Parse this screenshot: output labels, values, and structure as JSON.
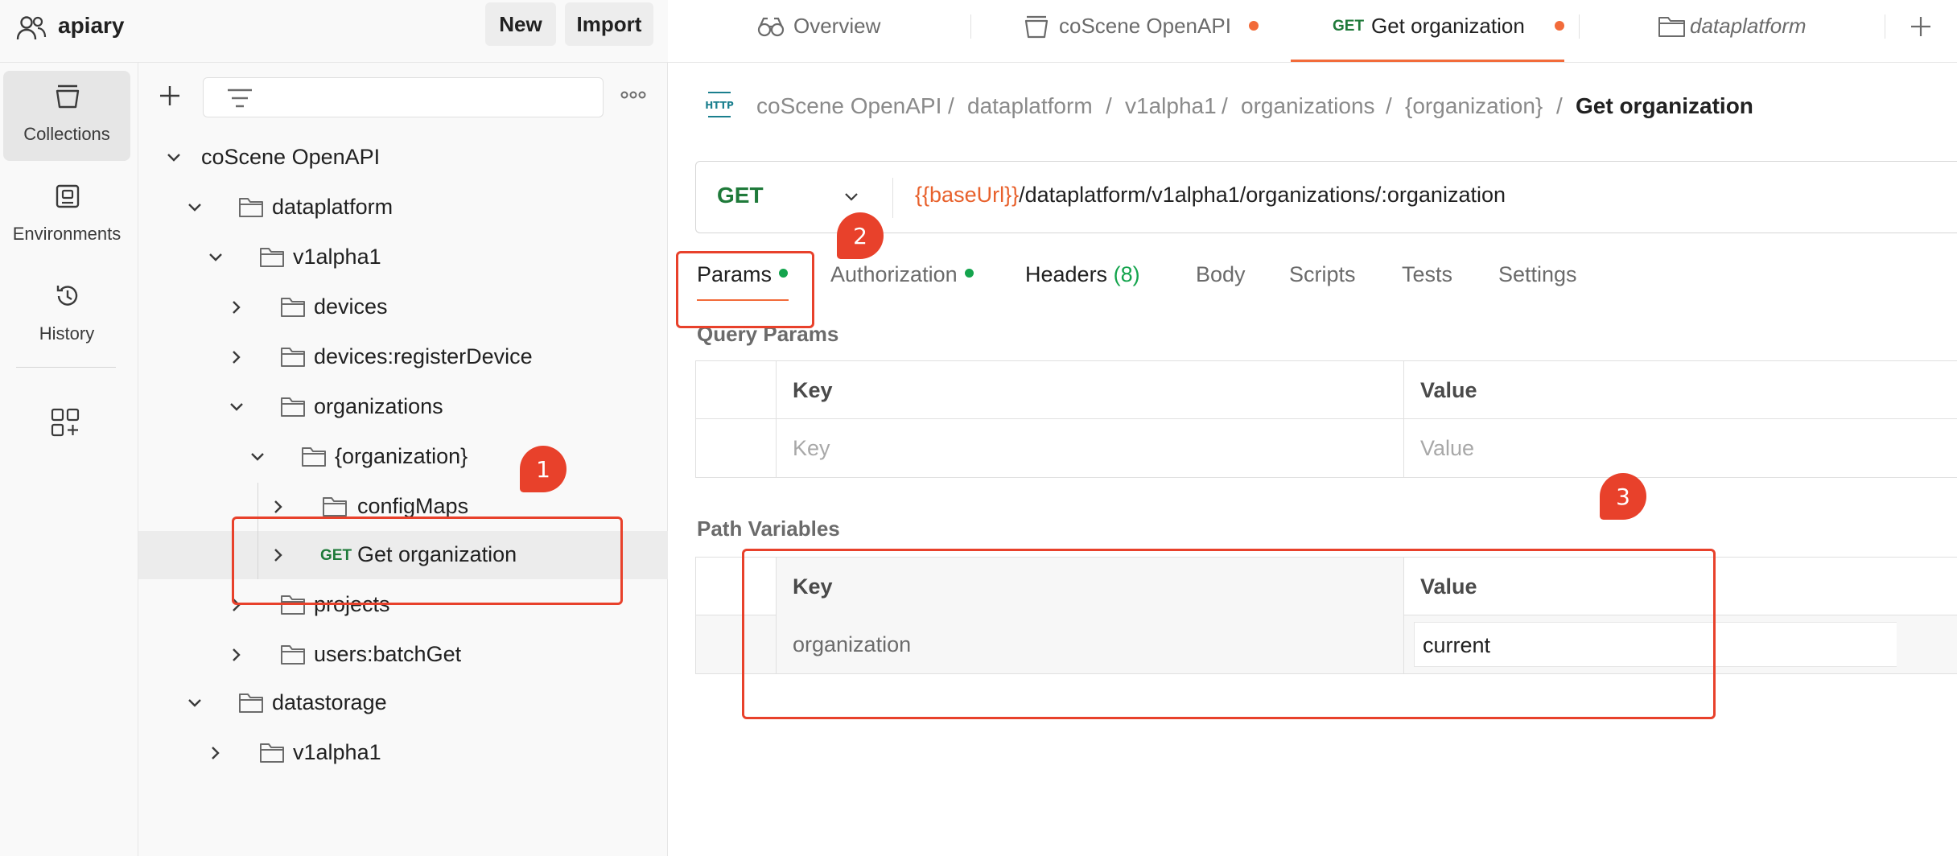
{
  "workspace": {
    "name": "apiary",
    "new_label": "New",
    "import_label": "Import"
  },
  "rail": {
    "items": [
      {
        "label": "Collections",
        "icon": "collections-icon",
        "active": true
      },
      {
        "label": "Environments",
        "icon": "environments-icon",
        "active": false
      },
      {
        "label": "History",
        "icon": "history-icon",
        "active": false
      }
    ],
    "apps_icon": "add-apps-icon"
  },
  "sidebar": {
    "tree": [
      {
        "label": "coScene OpenAPI",
        "expanded": true
      },
      {
        "label": "dataplatform",
        "expanded": true
      },
      {
        "label": "v1alpha1",
        "expanded": true
      },
      {
        "label": "devices",
        "expanded": false
      },
      {
        "label": "devices:registerDevice",
        "expanded": false
      },
      {
        "label": "organizations",
        "expanded": true
      },
      {
        "label": "{organization}",
        "expanded": true
      },
      {
        "label": "configMaps",
        "expanded": false
      },
      {
        "label": "Get organization",
        "method": "GET",
        "selected": true
      },
      {
        "label": "projects",
        "expanded": false
      },
      {
        "label": "users:batchGet",
        "expanded": false
      },
      {
        "label": "datastorage",
        "expanded": true
      },
      {
        "label": "v1alpha1",
        "expanded": false
      }
    ]
  },
  "tabs": [
    {
      "label": "Overview",
      "icon": "overview-icon",
      "dirty": false
    },
    {
      "label": "coScene OpenAPI",
      "icon": "collection-icon",
      "dirty": true
    },
    {
      "label": "Get organization",
      "method": "GET",
      "dirty": true,
      "active": true
    },
    {
      "label": "dataplatform",
      "icon": "folder-icon",
      "dirty": false
    }
  ],
  "breadcrumb": {
    "icon_text": "HTTP",
    "parts": [
      "coScene OpenAPI",
      "dataplatform",
      "v1alpha1",
      "organizations",
      "{organization}"
    ],
    "separator": "/",
    "current": "Get organization"
  },
  "request": {
    "method": "GET",
    "url_variable": "{{baseUrl}}",
    "url_path": "/dataplatform/v1alpha1/organizations/:organization"
  },
  "request_tabs": [
    {
      "label": "Params",
      "dot": true,
      "active": true
    },
    {
      "label": "Authorization",
      "dot": true
    },
    {
      "label": "Headers",
      "count": "(8)"
    },
    {
      "label": "Body"
    },
    {
      "label": "Scripts"
    },
    {
      "label": "Tests"
    },
    {
      "label": "Settings"
    }
  ],
  "query_params": {
    "title": "Query Params",
    "header_key": "Key",
    "header_value": "Value",
    "placeholder_key": "Key",
    "placeholder_value": "Value"
  },
  "path_variables": {
    "title": "Path Variables",
    "header_key": "Key",
    "header_value": "Value",
    "rows": [
      {
        "key": "organization",
        "value": "current"
      }
    ]
  },
  "annotations": [
    "1",
    "2",
    "3"
  ],
  "colors": {
    "accent": "#f26b3a",
    "get_method": "#1f7a3a",
    "status_dot": "#14a44d",
    "annotation": "#e8412b"
  }
}
